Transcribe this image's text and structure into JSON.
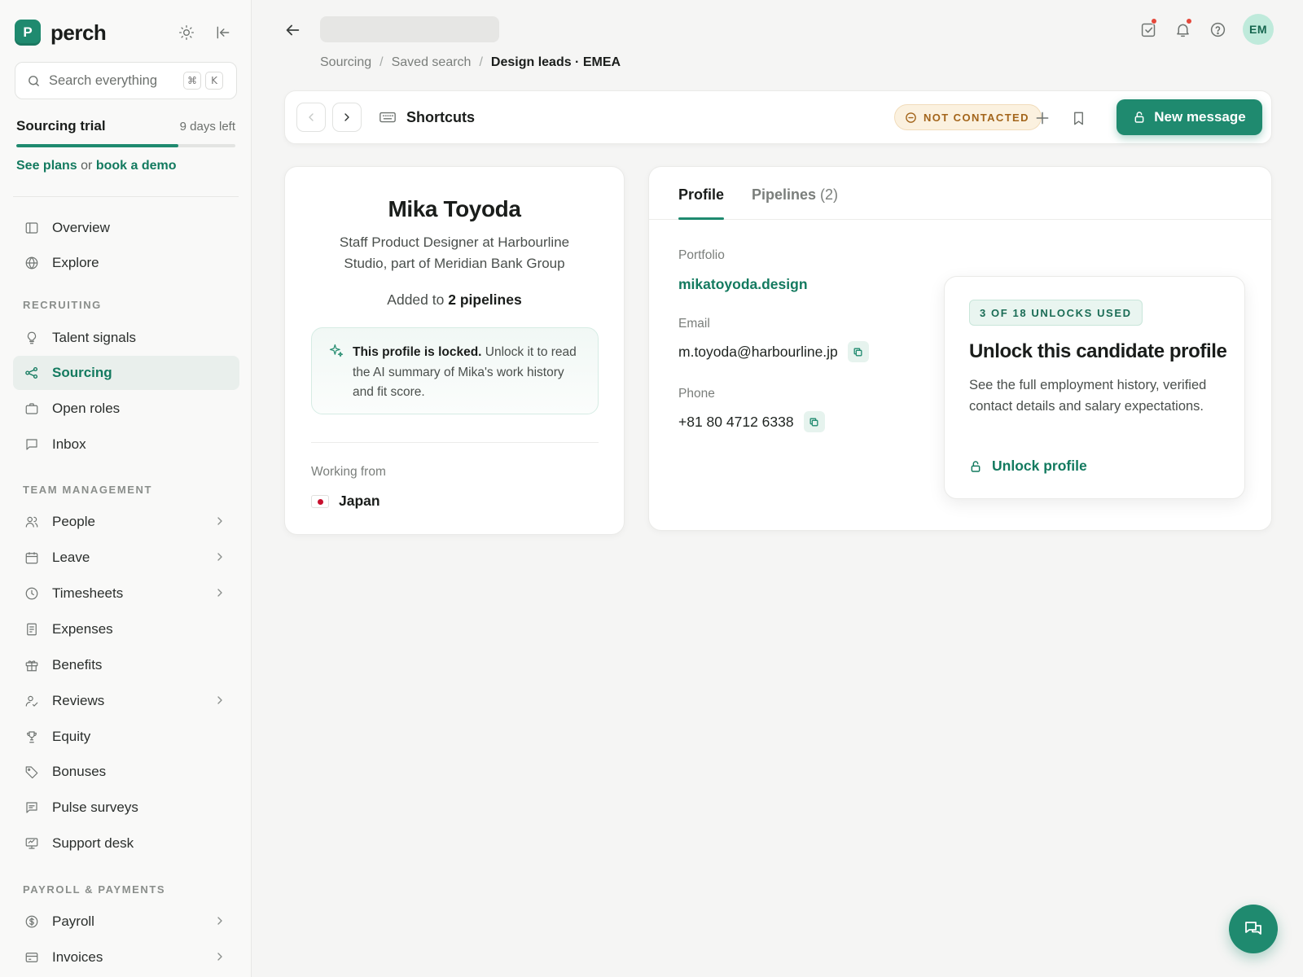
{
  "app": {
    "name": "perch",
    "logo_letter": "P"
  },
  "search": {
    "placeholder": "Search everything",
    "shortcut_keys": [
      "⌘",
      "K"
    ]
  },
  "trial": {
    "title": "Sourcing trial",
    "days_left": "9 days left",
    "progress_fraction": 0.74,
    "see_plans": "See plans",
    "or": "or",
    "book_demo": "book a demo"
  },
  "nav": {
    "overview": "Overview",
    "explore": "Explore",
    "recruiting_label": "RECRUITING",
    "talent_signals": "Talent signals",
    "sourcing": "Sourcing",
    "open_roles": "Open roles",
    "inbox": "Inbox",
    "team_label": "TEAM MANAGEMENT",
    "people": "People",
    "leave": "Leave",
    "timesheets": "Timesheets",
    "expenses": "Expenses",
    "benefits": "Benefits",
    "reviews": "Reviews",
    "equity": "Equity",
    "bonuses": "Bonuses",
    "pulse_surveys": "Pulse surveys",
    "support_desk": "Support desk",
    "payroll_label": "PAYROLL & PAYMENTS",
    "payroll": "Payroll",
    "invoices": "Invoices"
  },
  "header": {
    "breadcrumb": [
      "Sourcing",
      "Saved search",
      "Design leads · EMEA"
    ],
    "separator": "/",
    "avatar_initials": "EM"
  },
  "toolbar": {
    "shortcuts_label": "Shortcuts",
    "status": "NOT CONTACTED",
    "new_message": "New message"
  },
  "profile": {
    "name": "Mika Toyoda",
    "role": "Staff Product Designer at Harbourline Studio, part of Meridian Bank Group",
    "added_prefix": "Added to",
    "added_count": "2 pipelines",
    "locked_title": "This profile is locked.",
    "locked_body": "Unlock it to read the AI summary of Mika's work history and fit score.",
    "working_from_label": "Working from",
    "working_from": "Japan"
  },
  "tabs": {
    "profile": "Profile",
    "pipelines": "Pipelines",
    "pipelines_count": "(2)"
  },
  "details": {
    "portfolio_label": "Portfolio",
    "portfolio": "mikatoyoda.design",
    "email_label": "Email",
    "email": "m.toyoda@harbourline.jp",
    "phone_label": "Phone",
    "phone": "+81 80 4712 6338"
  },
  "unlock": {
    "badge": "3 OF 18 UNLOCKS USED",
    "title": "Unlock this candidate profile",
    "description": "See the full employment history, verified contact details and salary expectations.",
    "action": "Unlock profile"
  },
  "colors": {
    "brand": "#1f8a6f",
    "status_warn": "#a3651b",
    "alert": "#e5483b"
  }
}
